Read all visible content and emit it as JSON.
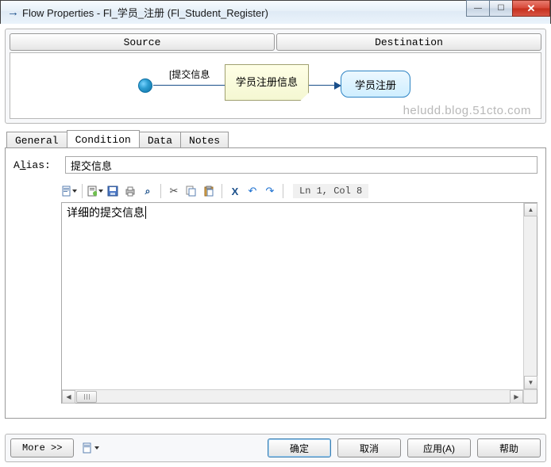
{
  "window": {
    "title": "Flow Properties - Fl_学员_注册 (Fl_Student_Register)"
  },
  "panel": {
    "source_label": "Source",
    "dest_label": "Destination"
  },
  "diagram": {
    "edge_label": "[提交信息",
    "note_text": "学员注册信息",
    "dest_text": "学员注册",
    "watermark": "heludd.blog.51cto.com"
  },
  "tabs": {
    "general": "General",
    "condition": "Condition",
    "data": "Data",
    "notes": "Notes",
    "active": "condition"
  },
  "condition": {
    "alias_label_pre": "A",
    "alias_label_u": "l",
    "alias_label_post": "ias:",
    "alias_value": "提交信息",
    "editor_text": "详细的提交信息",
    "cursor_status": "Ln 1, Col 8"
  },
  "buttons": {
    "more": "More >>",
    "ok": "确定",
    "cancel": "取消",
    "apply": "应用(A)",
    "help": "帮助"
  }
}
